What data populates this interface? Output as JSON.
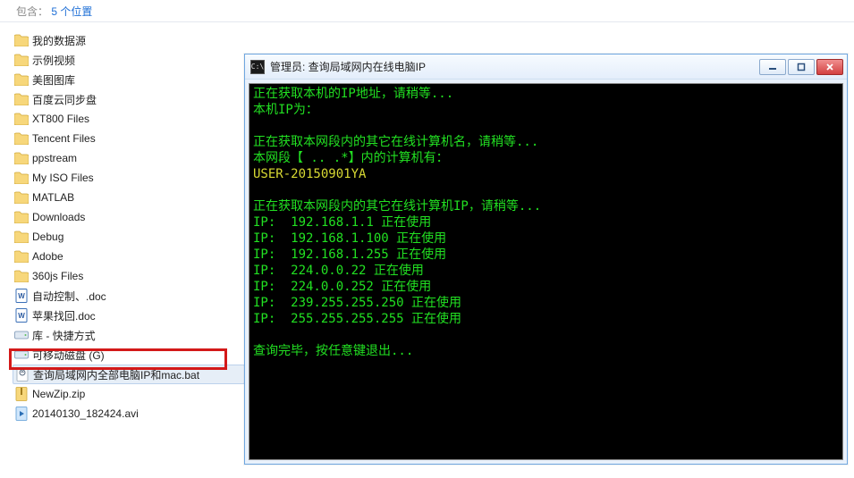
{
  "header": {
    "prefix": "包含：",
    "count": "5 个位置"
  },
  "files": [
    {
      "type": "folder",
      "label": "我的数据源"
    },
    {
      "type": "folder",
      "label": "示例视频"
    },
    {
      "type": "folder",
      "label": "美图图库"
    },
    {
      "type": "folder",
      "label": "百度云同步盘"
    },
    {
      "type": "folder",
      "label": "XT800 Files"
    },
    {
      "type": "folder",
      "label": "Tencent Files"
    },
    {
      "type": "folder",
      "label": "ppstream"
    },
    {
      "type": "folder",
      "label": "My ISO Files"
    },
    {
      "type": "folder",
      "label": "MATLAB"
    },
    {
      "type": "folder",
      "label": "Downloads"
    },
    {
      "type": "folder",
      "label": "Debug"
    },
    {
      "type": "folder",
      "label": "Adobe"
    },
    {
      "type": "folder",
      "label": "360js Files"
    },
    {
      "type": "doc",
      "label": "自动控制、.doc"
    },
    {
      "type": "doc",
      "label": "苹果找回.doc"
    },
    {
      "type": "drive",
      "label": "库 - 快捷方式"
    },
    {
      "type": "drive",
      "label": "可移动磁盘 (G)"
    },
    {
      "type": "bat",
      "label": "查询局域网内全部电脑IP和mac.bat",
      "selected": true
    },
    {
      "type": "zip",
      "label": "NewZip.zip"
    },
    {
      "type": "video",
      "label": "20140130_182424.avi"
    }
  ],
  "console": {
    "icon_text": "C:\\",
    "title": "管理员:  查询局域网内在线电脑IP",
    "lines": [
      {
        "cls": "g",
        "text": "正在获取本机的IP地址，请稍等..."
      },
      {
        "cls": "g",
        "text": "本机IP为："
      },
      {
        "cls": "",
        "text": ""
      },
      {
        "cls": "g",
        "text": "正在获取本网段内的其它在线计算机名，请稍等..."
      },
      {
        "cls": "g",
        "text": "本网段【 .. .*】内的计算机有："
      },
      {
        "cls": "y",
        "text": "USER-20150901YA"
      },
      {
        "cls": "",
        "text": ""
      },
      {
        "cls": "g",
        "text": "正在获取本网段内的其它在线计算机IP，请稍等..."
      },
      {
        "cls": "g",
        "text": "IP:  192.168.1.1 正在使用"
      },
      {
        "cls": "g",
        "text": "IP:  192.168.1.100 正在使用"
      },
      {
        "cls": "g",
        "text": "IP:  192.168.1.255 正在使用"
      },
      {
        "cls": "g",
        "text": "IP:  224.0.0.22 正在使用"
      },
      {
        "cls": "g",
        "text": "IP:  224.0.0.252 正在使用"
      },
      {
        "cls": "g",
        "text": "IP:  239.255.255.250 正在使用"
      },
      {
        "cls": "g",
        "text": "IP:  255.255.255.255 正在使用"
      },
      {
        "cls": "",
        "text": ""
      },
      {
        "cls": "g",
        "text": "查询完毕，按任意键退出..."
      }
    ]
  }
}
